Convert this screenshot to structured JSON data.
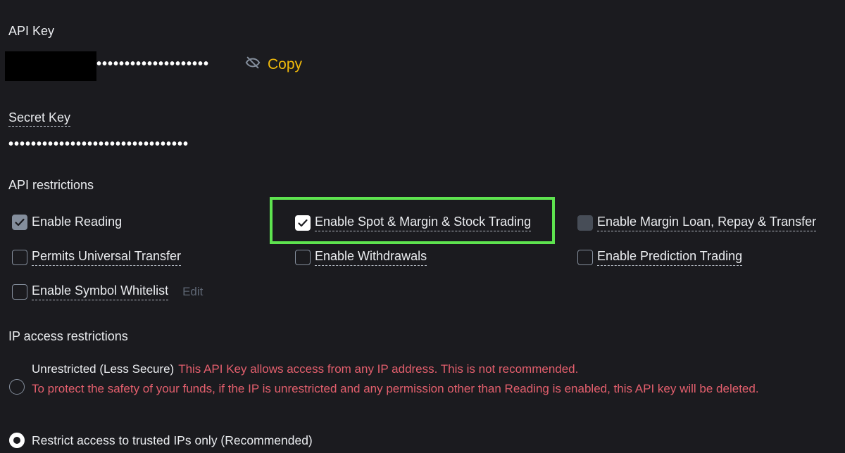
{
  "api_key": {
    "label": "API Key",
    "masked_value": "••••••••••••••••••••",
    "copy_label": "Copy",
    "icon": "eye-off-icon"
  },
  "secret_key": {
    "label": "Secret Key",
    "masked_value": "••••••••••••••••••••••••••••••••"
  },
  "api_restrictions": {
    "title": "API restrictions",
    "options": [
      {
        "label": "Enable Reading",
        "state": "checked"
      },
      {
        "label": "Enable Spot & Margin & Stock Trading",
        "state": "checked"
      },
      {
        "label": "Enable Margin Loan, Repay & Transfer",
        "state": "disabled"
      },
      {
        "label": "Permits Universal Transfer",
        "state": "unchecked"
      },
      {
        "label": "Enable Withdrawals",
        "state": "unchecked"
      },
      {
        "label": "Enable Prediction Trading",
        "state": "unchecked"
      },
      {
        "label": "Enable Symbol Whitelist",
        "state": "unchecked"
      }
    ],
    "edit_label": "Edit"
  },
  "ip_access": {
    "title": "IP access restrictions",
    "unrestricted": {
      "label": "Unrestricted (Less Secure)",
      "warning_1": "This API Key allows access from any IP address. This is not recommended.",
      "warning_2": "To protect the safety of your funds, if the IP is unrestricted and any permission other than Reading is enabled, this API key will be deleted.",
      "selected": false
    },
    "restricted": {
      "label": "Restrict access to trusted IPs only (Recommended)",
      "selected": true
    }
  },
  "colors": {
    "background": "#1b1b1f",
    "accent": "#f0b90b",
    "warning": "#e35f6d",
    "highlight": "#5ee34f"
  }
}
